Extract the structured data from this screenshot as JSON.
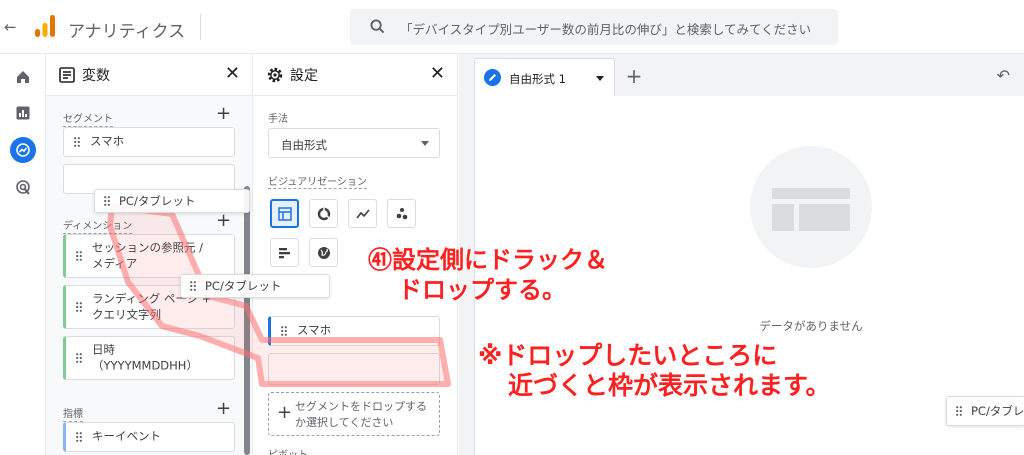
{
  "header": {
    "back_icon": "arrow-left-icon",
    "title": "アナリティクス",
    "search_placeholder": "「デバイスタイプ別ユーザー数の前月比の伸び」と検索してみてください"
  },
  "rail": {
    "items": [
      "home-icon",
      "reports-icon",
      "explore-icon",
      "advertising-icon"
    ],
    "active": "explore-icon"
  },
  "variables": {
    "title": "変数",
    "segments_label": "セグメント",
    "segments": [
      "スマホ"
    ],
    "dimensions_label": "ディメンション",
    "dimensions": [
      "セッションの参照元 / メディア",
      "ランディング ページ + クエリ文字列",
      "日時 （YYYYMMDDHH）"
    ],
    "metrics_label": "指標",
    "metrics": [
      "キーイベント"
    ]
  },
  "settings": {
    "title": "設定",
    "technique_label": "手法",
    "technique_value": "自由形式",
    "visualization_label": "ビジュアリゼーション",
    "segment_chip": "スマホ",
    "add_segment": "セグメントをドロップするか選択してください",
    "pivot_label": "ピボット"
  },
  "canvas": {
    "tab_label": "自由形式 1",
    "empty_text": "データがありません"
  },
  "drag": {
    "label": "PC/タブレット",
    "side_label": "PC/タブレ"
  },
  "annotations": {
    "note1_line1": "㊶設定側にドラック＆",
    "note1_line2": "ドロップする。",
    "note2_line1": "※ドロップしたいところに",
    "note2_line2": "近づくと枠が表示されます。"
  },
  "colors": {
    "accent": "#1a73e8",
    "annotation": "#ff2020",
    "dimension_bar": "#81c995",
    "metric_bar": "#8ab4f8"
  }
}
